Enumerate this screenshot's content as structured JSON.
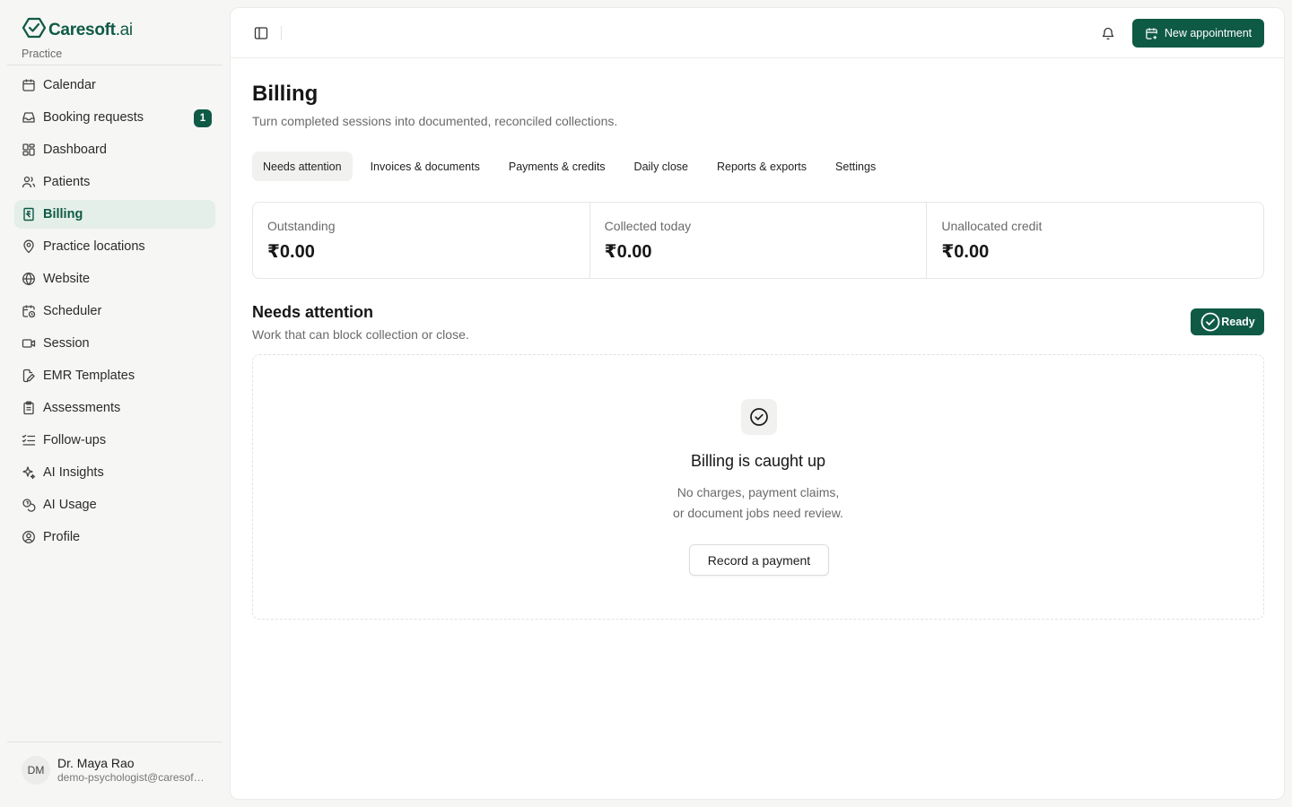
{
  "brand": {
    "name": "Caresoft",
    "suffix": ".ai",
    "subtitle": "Practice"
  },
  "sidebar": {
    "items": [
      {
        "label": "Calendar",
        "icon": "calendar-icon"
      },
      {
        "label": "Booking requests",
        "icon": "inbox-icon",
        "badge": "1"
      },
      {
        "label": "Dashboard",
        "icon": "dashboard-icon"
      },
      {
        "label": "Patients",
        "icon": "users-icon"
      },
      {
        "label": "Billing",
        "icon": "receipt-icon",
        "active": true
      },
      {
        "label": "Practice locations",
        "icon": "map-pin-icon"
      },
      {
        "label": "Website",
        "icon": "globe-icon"
      },
      {
        "label": "Scheduler",
        "icon": "calendar-clock-icon"
      },
      {
        "label": "Session",
        "icon": "video-icon"
      },
      {
        "label": "EMR Templates",
        "icon": "file-edit-icon"
      },
      {
        "label": "Assessments",
        "icon": "clipboard-icon"
      },
      {
        "label": "Follow-ups",
        "icon": "list-checks-icon"
      },
      {
        "label": "AI Insights",
        "icon": "sparkles-icon"
      },
      {
        "label": "AI Usage",
        "icon": "coins-icon"
      },
      {
        "label": "Profile",
        "icon": "user-circle-icon"
      }
    ]
  },
  "user": {
    "initials": "DM",
    "name": "Dr. Maya Rao",
    "email": "demo-psychologist@caresoft.ai"
  },
  "topbar": {
    "new_appointment_label": "New appointment"
  },
  "page": {
    "title": "Billing",
    "subtitle": "Turn completed sessions into documented, reconciled collections."
  },
  "tabs": [
    {
      "label": "Needs attention",
      "active": true
    },
    {
      "label": "Invoices & documents"
    },
    {
      "label": "Payments & credits"
    },
    {
      "label": "Daily close"
    },
    {
      "label": "Reports & exports"
    },
    {
      "label": "Settings"
    }
  ],
  "stats": [
    {
      "label": "Outstanding",
      "value": "₹0.00"
    },
    {
      "label": "Collected today",
      "value": "₹0.00"
    },
    {
      "label": "Unallocated credit",
      "value": "₹0.00"
    }
  ],
  "section": {
    "title": "Needs attention",
    "subtitle": "Work that can block collection or close.",
    "status": "Ready"
  },
  "empty_state": {
    "title": "Billing is caught up",
    "line1": "No charges, payment claims,",
    "line2": "or document jobs need review.",
    "button": "Record a payment"
  },
  "colors": {
    "accent": "#0f5a45",
    "active_bg": "#e4efe9"
  }
}
